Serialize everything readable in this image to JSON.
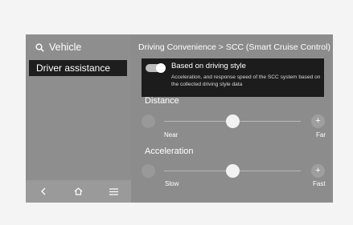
{
  "left_panel": {
    "search_label": "Vehicle",
    "nav_items": [
      {
        "label": "Driver assistance",
        "selected": true
      }
    ],
    "bottom_icons": [
      "back-icon",
      "home-icon",
      "menu-icon"
    ]
  },
  "header": {
    "breadcrumb": "Driving Convenience > SCC (Smart Cruise Control)"
  },
  "popup": {
    "toggle_on": true,
    "title": "Based on driving style",
    "description": "Acceleration, and response speed of the SCC system based on the collected driving style data"
  },
  "sliders": {
    "distance": {
      "label": "Distance",
      "min_label": "Near",
      "max_label": "Far",
      "level": 0.5
    },
    "acceleration": {
      "label": "Acceleration",
      "min_label": "Slow",
      "max_label": "Fast",
      "level": 0.5
    }
  },
  "icons": {
    "plus": "+"
  }
}
